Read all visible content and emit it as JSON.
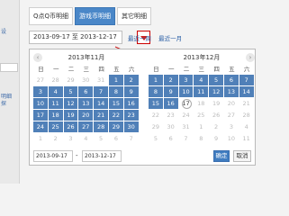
{
  "sidebar": {
    "frag1": "设",
    "frag2": "明细",
    "frag3": "探"
  },
  "tabs": [
    {
      "label": "Q点Q币明细"
    },
    {
      "label": "游戏币明细"
    },
    {
      "label": "其它明细"
    }
  ],
  "range": {
    "start": "2013-09-17",
    "sep": "至",
    "end": "2013-12-17"
  },
  "quick_links": {
    "week": "最近一周",
    "month": "最近一月"
  },
  "weekdays": [
    "日",
    "一",
    "二",
    "三",
    "四",
    "五",
    "六"
  ],
  "calendars": [
    {
      "title": "2013年11月",
      "days": [
        [
          "27",
          "out"
        ],
        [
          "28",
          "out"
        ],
        [
          "29",
          "out"
        ],
        [
          "30",
          "out"
        ],
        [
          "31",
          "out"
        ],
        [
          "1",
          "in"
        ],
        [
          "2",
          "in"
        ],
        [
          "3",
          "in"
        ],
        [
          "4",
          "in"
        ],
        [
          "5",
          "in"
        ],
        [
          "6",
          "in"
        ],
        [
          "7",
          "in"
        ],
        [
          "8",
          "in"
        ],
        [
          "9",
          "in"
        ],
        [
          "10",
          "in"
        ],
        [
          "11",
          "in"
        ],
        [
          "12",
          "in"
        ],
        [
          "13",
          "in"
        ],
        [
          "14",
          "in"
        ],
        [
          "15",
          "in"
        ],
        [
          "16",
          "in"
        ],
        [
          "17",
          "in"
        ],
        [
          "18",
          "in"
        ],
        [
          "19",
          "in"
        ],
        [
          "20",
          "in"
        ],
        [
          "21",
          "in"
        ],
        [
          "22",
          "in"
        ],
        [
          "23",
          "in"
        ],
        [
          "24",
          "in"
        ],
        [
          "25",
          "in"
        ],
        [
          "26",
          "in"
        ],
        [
          "27",
          "in"
        ],
        [
          "28",
          "in"
        ],
        [
          "29",
          "in"
        ],
        [
          "30",
          "in"
        ],
        [
          "1",
          "out"
        ],
        [
          "2",
          "out"
        ],
        [
          "3",
          "out"
        ],
        [
          "4",
          "out"
        ],
        [
          "5",
          "out"
        ],
        [
          "6",
          "out"
        ],
        [
          "7",
          "out"
        ]
      ]
    },
    {
      "title": "2013年12月",
      "days": [
        [
          "1",
          "in"
        ],
        [
          "2",
          "in"
        ],
        [
          "3",
          "in"
        ],
        [
          "4",
          "in"
        ],
        [
          "5",
          "in"
        ],
        [
          "6",
          "in"
        ],
        [
          "7",
          "in"
        ],
        [
          "8",
          "in"
        ],
        [
          "9",
          "in"
        ],
        [
          "10",
          "in"
        ],
        [
          "11",
          "in"
        ],
        [
          "12",
          "in"
        ],
        [
          "13",
          "in"
        ],
        [
          "14",
          "in"
        ],
        [
          "15",
          "in"
        ],
        [
          "16",
          "in"
        ],
        [
          "17",
          "today"
        ],
        [
          "18",
          "out"
        ],
        [
          "19",
          "out"
        ],
        [
          "20",
          "out"
        ],
        [
          "21",
          "out"
        ],
        [
          "22",
          "out"
        ],
        [
          "23",
          "out"
        ],
        [
          "24",
          "out"
        ],
        [
          "25",
          "out"
        ],
        [
          "26",
          "out"
        ],
        [
          "27",
          "out"
        ],
        [
          "28",
          "out"
        ],
        [
          "29",
          "out"
        ],
        [
          "30",
          "out"
        ],
        [
          "31",
          "out"
        ],
        [
          "1",
          "out"
        ],
        [
          "2",
          "out"
        ],
        [
          "3",
          "out"
        ],
        [
          "4",
          "out"
        ],
        [
          "5",
          "out"
        ],
        [
          "6",
          "out"
        ],
        [
          "7",
          "out"
        ],
        [
          "8",
          "out"
        ],
        [
          "9",
          "out"
        ],
        [
          "10",
          "out"
        ],
        [
          "11",
          "out"
        ]
      ]
    }
  ],
  "footer": {
    "start": "2013-09-17",
    "sep": "-",
    "end": "2013-12-17",
    "ok": "确定",
    "cancel": "取消"
  },
  "colors": {
    "accent": "#4a87c8",
    "selected_day": "#5080b8",
    "annotation": "#cc2222"
  }
}
